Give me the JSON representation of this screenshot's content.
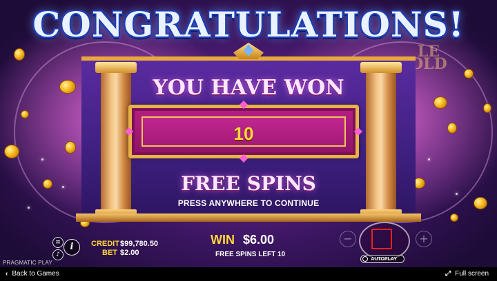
{
  "banner": {
    "title": "CONGRATULATIONS!"
  },
  "dialog": {
    "heading": "YOU HAVE WON",
    "amount": "10",
    "subheading": "FREE SPINS",
    "prompt": "PRESS ANYWHERE TO CONTINUE"
  },
  "hud": {
    "credit_label": "CREDIT",
    "credit_value": "$99,780.50",
    "bet_label": "BET",
    "bet_value": "$2.00",
    "win_label": "WIN",
    "win_value": "$6.00",
    "free_spins_left": "FREE SPINS LEFT 10",
    "minus_symbol": "−",
    "plus_symbol": "+",
    "info_symbol": "i",
    "autoplay_label": "AUTOPLAY",
    "brand": "PRAGMATIC PLAY"
  },
  "footer": {
    "back_label": "Back to Games",
    "back_icon": "chevron-left-icon",
    "fullscreen_label": "Full screen",
    "fullscreen_icon": "expand-icon"
  },
  "colors": {
    "title_text": "#eaf2ff",
    "gold": "#ffd83a",
    "panel_purple": "#3d1f7e",
    "win_box_magenta": "#b71e84",
    "spin_square": "#e52222"
  }
}
